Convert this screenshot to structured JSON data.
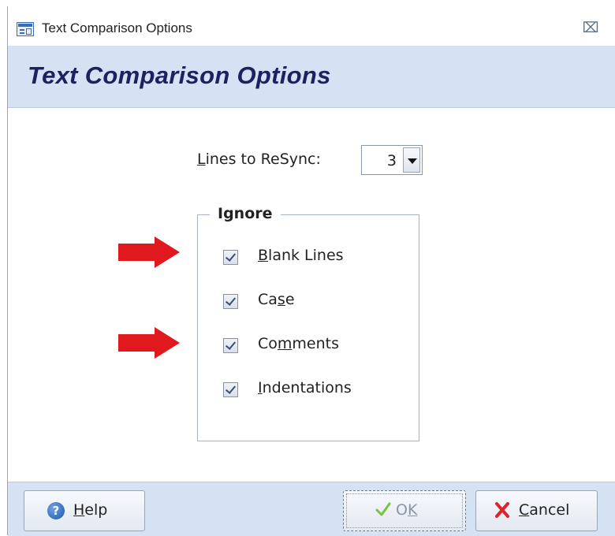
{
  "window": {
    "title": "Text Comparison Options",
    "close_icon": "close-icon"
  },
  "header": {
    "form_title": "Text Comparison Options"
  },
  "resync": {
    "label_prefix": "L",
    "label_rest": "ines to ReSync:",
    "value": "3"
  },
  "ignore_group": {
    "legend": "Ignore",
    "items": [
      {
        "label_before": "",
        "label_u": "B",
        "label_after": "lank Lines",
        "checked": true,
        "highlighted": true
      },
      {
        "label_before": "Ca",
        "label_u": "s",
        "label_after": "e",
        "checked": true,
        "highlighted": false
      },
      {
        "label_before": "Co",
        "label_u": "m",
        "label_after": "ments",
        "checked": true,
        "highlighted": true
      },
      {
        "label_before": "",
        "label_u": "I",
        "label_after": "ndentations",
        "checked": true,
        "highlighted": false
      }
    ]
  },
  "footer": {
    "help": {
      "u": "H",
      "rest": "elp"
    },
    "ok": {
      "before": "O",
      "u": "K"
    },
    "cancel": {
      "u": "C",
      "rest": "ancel"
    }
  },
  "colors": {
    "header_band": "#d5e2f4",
    "title_text": "#1a2260",
    "arrow": "#e0191e"
  }
}
